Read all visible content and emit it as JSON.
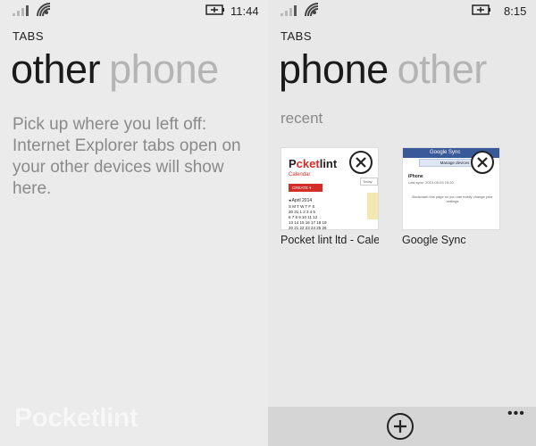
{
  "left": {
    "status": {
      "time": "11:44"
    },
    "tabs_label": "TABS",
    "pivot": {
      "active": "other",
      "inactive": "phone"
    },
    "message": "Pick up where you left off: Internet Explorer tabs open on your other devices will show here.",
    "watermark": "Pocketlint"
  },
  "right": {
    "status": {
      "time": "8:15"
    },
    "tabs_label": "TABS",
    "pivot": {
      "active": "phone",
      "inactive": "other"
    },
    "section_label": "recent",
    "tiles": [
      {
        "caption": "Pocket lint ltd - Cale",
        "preview": {
          "logo_a": "P",
          "logo_b": "cket",
          "logo_c": "lint",
          "calendar": "Calendar",
          "create": "CREATE ▾",
          "today": "Today",
          "month": "◂ April 2014",
          "grid": "S M T W T F S\n30 31 1 2 3 4 5\n6 7 8 9 10 11 12\n13 14 15 16 17 18 19\n20 21 22 23 24 25 26"
        }
      },
      {
        "caption": "Google Sync",
        "preview": {
          "header": "Google Sync",
          "manage": "Manage devices",
          "device": "iPhone",
          "last_sync": "Last sync: 2013-05-03 15:20",
          "note": "Bookmark this page so you can easily change your settings"
        }
      }
    ],
    "appbar": {
      "more": "•••"
    }
  },
  "colors": {
    "background": "#ebebeb",
    "appbar": "#d5d5d5",
    "accent_red": "#d32d27"
  }
}
